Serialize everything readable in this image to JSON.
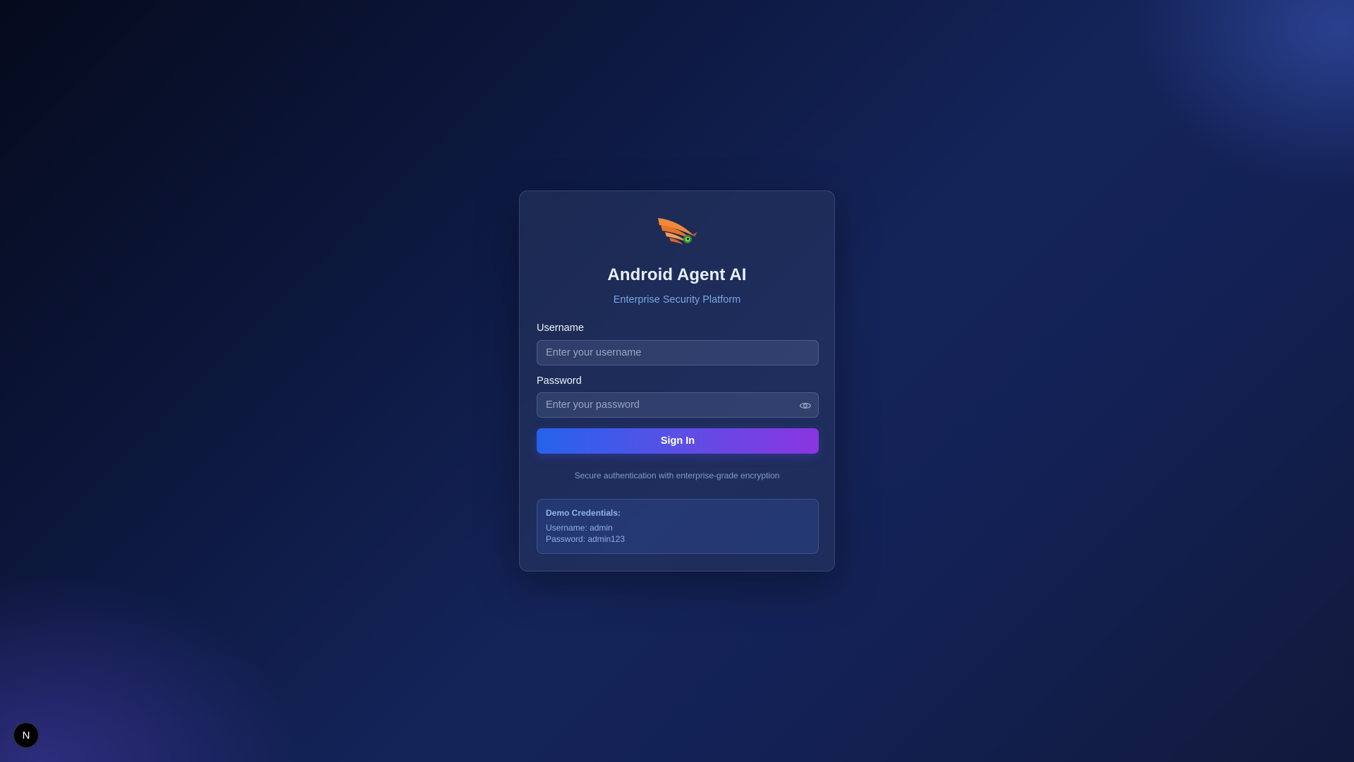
{
  "app": {
    "title": "Android Agent AI",
    "subtitle": "Enterprise Security Platform",
    "logo_icon": "eagle-eye-logo"
  },
  "form": {
    "username_label": "Username",
    "username_placeholder": "Enter your username",
    "username_value": "",
    "password_label": "Password",
    "password_placeholder": "Enter your password",
    "password_value": "",
    "password_toggle_icon": "eye-icon",
    "signin_label": "Sign In"
  },
  "security_note": "Secure authentication with enterprise-grade encryption",
  "demo": {
    "title": "Demo Credentials:",
    "username_line": "Username: admin",
    "password_line": "Password: admin123"
  },
  "corner_badge": {
    "label": "N"
  },
  "colors": {
    "accent_start": "#2563eb",
    "accent_end": "#8b35e0",
    "subtitle": "#7aa6e6",
    "background": "#0e1a44"
  }
}
